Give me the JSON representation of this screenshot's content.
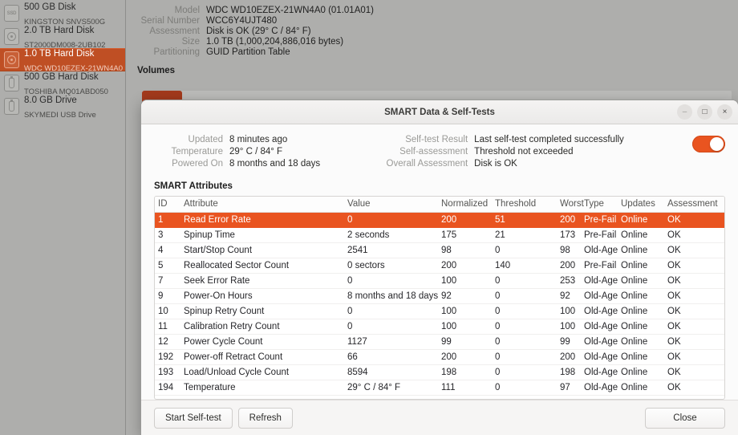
{
  "sidebar": {
    "devices": [
      {
        "title": "500 GB Disk",
        "sub": "KINGSTON SNVS500G",
        "icon": "ssd-icon",
        "selected": false
      },
      {
        "title": "2.0 TB Hard Disk",
        "sub": "ST2000DM008-2UB102",
        "icon": "hard-disk-icon",
        "selected": false
      },
      {
        "title": "1.0 TB Hard Disk",
        "sub": "WDC WD10EZEX-21WN4A0",
        "icon": "hard-disk-icon",
        "selected": true
      },
      {
        "title": "500 GB Hard Disk",
        "sub": "TOSHIBA MQ01ABD050",
        "icon": "usb-drive-icon",
        "selected": false
      },
      {
        "title": "8.0 GB Drive",
        "sub": "SKYMEDI USB Drive",
        "icon": "usb-stick-icon",
        "selected": false
      }
    ]
  },
  "disk_info": {
    "rows": [
      {
        "label": "Model",
        "value": "WDC WD10EZEX-21WN4A0 (01.01A01)"
      },
      {
        "label": "Serial Number",
        "value": "WCC6Y4UJT480"
      },
      {
        "label": "Assessment",
        "value": "Disk is OK (29° C / 84° F)"
      },
      {
        "label": "Size",
        "value": "1.0 TB (1,000,204,886,016 bytes)"
      },
      {
        "label": "Partitioning",
        "value": "GUID Partition Table"
      }
    ],
    "volumes_heading": "Volumes"
  },
  "dialog": {
    "title": "SMART Data & Self-Tests",
    "window_controls": {
      "minimize": "–",
      "maximize": "□",
      "close": "×"
    },
    "summary_left": [
      {
        "label": "Updated",
        "value": "8 minutes ago"
      },
      {
        "label": "Temperature",
        "value": "29° C / 84° F"
      },
      {
        "label": "Powered On",
        "value": "8 months and 18 days"
      }
    ],
    "summary_right": [
      {
        "label": "Self-test Result",
        "value": "Last self-test completed successfully"
      },
      {
        "label": "Self-assessment",
        "value": "Threshold not exceeded"
      },
      {
        "label": "Overall Assessment",
        "value": "Disk is OK"
      }
    ],
    "smart_toggle": {
      "name": "smart-enabled-toggle",
      "state": "on",
      "color": "#e95420"
    },
    "attributes_heading": "SMART Attributes",
    "table": {
      "columns": [
        "ID",
        "Attribute",
        "Value",
        "Normalized",
        "Threshold",
        "Worst",
        "Type",
        "Updates",
        "Assessment"
      ],
      "rows": [
        {
          "id": "1",
          "attribute": "Read Error Rate",
          "value": "0",
          "normalized": "200",
          "threshold": "51",
          "worst": "200",
          "type": "Pre-Fail",
          "updates": "Online",
          "assessment": "OK",
          "highlight": true
        },
        {
          "id": "3",
          "attribute": "Spinup Time",
          "value": "2 seconds",
          "normalized": "175",
          "threshold": "21",
          "worst": "173",
          "type": "Pre-Fail",
          "updates": "Online",
          "assessment": "OK",
          "highlight": false
        },
        {
          "id": "4",
          "attribute": "Start/Stop Count",
          "value": "2541",
          "normalized": "98",
          "threshold": "0",
          "worst": "98",
          "type": "Old-Age",
          "updates": "Online",
          "assessment": "OK",
          "highlight": false
        },
        {
          "id": "5",
          "attribute": "Reallocated Sector Count",
          "value": "0 sectors",
          "normalized": "200",
          "threshold": "140",
          "worst": "200",
          "type": "Pre-Fail",
          "updates": "Online",
          "assessment": "OK",
          "highlight": false
        },
        {
          "id": "7",
          "attribute": "Seek Error Rate",
          "value": "0",
          "normalized": "100",
          "threshold": "0",
          "worst": "253",
          "type": "Old-Age",
          "updates": "Online",
          "assessment": "OK",
          "highlight": false
        },
        {
          "id": "9",
          "attribute": "Power-On Hours",
          "value": "8 months and 18 days",
          "normalized": "92",
          "threshold": "0",
          "worst": "92",
          "type": "Old-Age",
          "updates": "Online",
          "assessment": "OK",
          "highlight": false
        },
        {
          "id": "10",
          "attribute": "Spinup Retry Count",
          "value": "0",
          "normalized": "100",
          "threshold": "0",
          "worst": "100",
          "type": "Old-Age",
          "updates": "Online",
          "assessment": "OK",
          "highlight": false
        },
        {
          "id": "11",
          "attribute": "Calibration Retry Count",
          "value": "0",
          "normalized": "100",
          "threshold": "0",
          "worst": "100",
          "type": "Old-Age",
          "updates": "Online",
          "assessment": "OK",
          "highlight": false
        },
        {
          "id": "12",
          "attribute": "Power Cycle Count",
          "value": "1127",
          "normalized": "99",
          "threshold": "0",
          "worst": "99",
          "type": "Old-Age",
          "updates": "Online",
          "assessment": "OK",
          "highlight": false
        },
        {
          "id": "192",
          "attribute": "Power-off Retract Count",
          "value": "66",
          "normalized": "200",
          "threshold": "0",
          "worst": "200",
          "type": "Old-Age",
          "updates": "Online",
          "assessment": "OK",
          "highlight": false
        },
        {
          "id": "193",
          "attribute": "Load/Unload Cycle Count",
          "value": "8594",
          "normalized": "198",
          "threshold": "0",
          "worst": "198",
          "type": "Old-Age",
          "updates": "Online",
          "assessment": "OK",
          "highlight": false
        },
        {
          "id": "194",
          "attribute": "Temperature",
          "value": "29° C / 84° F",
          "normalized": "111",
          "threshold": "0",
          "worst": "97",
          "type": "Old-Age",
          "updates": "Online",
          "assessment": "OK",
          "highlight": false
        }
      ]
    },
    "buttons": {
      "start_self_test": "Start Self-test",
      "refresh": "Refresh",
      "close": "Close"
    }
  }
}
